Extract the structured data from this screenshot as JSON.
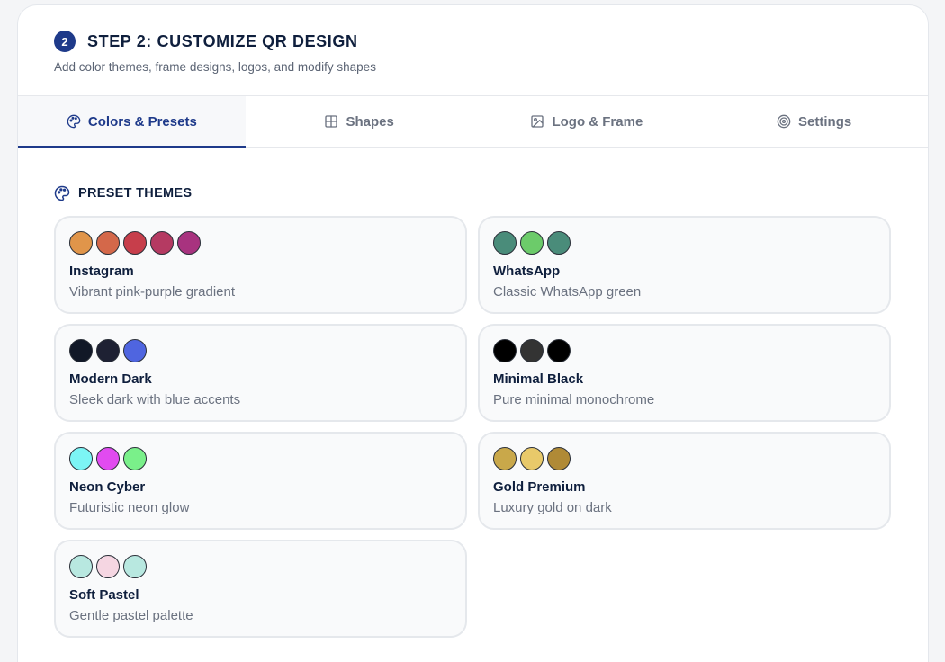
{
  "header": {
    "step_number": "2",
    "title": "STEP 2: CUSTOMIZE QR DESIGN",
    "subtitle": "Add color themes, frame designs, logos, and modify shapes"
  },
  "tabs": [
    {
      "label": "Colors & Presets",
      "icon": "palette-icon",
      "active": true
    },
    {
      "label": "Shapes",
      "icon": "grid-icon",
      "active": false
    },
    {
      "label": "Logo & Frame",
      "icon": "image-icon",
      "active": false
    },
    {
      "label": "Settings",
      "icon": "target-icon",
      "active": false
    }
  ],
  "section": {
    "title": "PRESET THEMES",
    "icon": "palette-icon"
  },
  "presets": [
    {
      "name": "Instagram",
      "description": "Vibrant pink-purple gradient",
      "colors": [
        "#E0954A",
        "#D4684A",
        "#C73E4B",
        "#B53A62",
        "#A8337F"
      ]
    },
    {
      "name": "WhatsApp",
      "description": "Classic WhatsApp green",
      "colors": [
        "#4A8C7A",
        "#6CCB6A",
        "#4A8C7A"
      ]
    },
    {
      "name": "Modern Dark",
      "description": "Sleek dark with blue accents",
      "colors": [
        "#111827",
        "#1E2133",
        "#4F65E0"
      ]
    },
    {
      "name": "Minimal Black",
      "description": "Pure minimal monochrome",
      "colors": [
        "#000000",
        "#333333",
        "#000000"
      ]
    },
    {
      "name": "Neon Cyber",
      "description": "Futuristic neon glow",
      "colors": [
        "#7CF5F5",
        "#E14BF0",
        "#7AF08A"
      ]
    },
    {
      "name": "Gold Premium",
      "description": "Luxury gold on dark",
      "colors": [
        "#C9A84A",
        "#E8C96A",
        "#B08A36"
      ]
    },
    {
      "name": "Soft Pastel",
      "description": "Gentle pastel palette",
      "colors": [
        "#B8E8E0",
        "#F5D6E2",
        "#B8E8E0"
      ]
    }
  ],
  "colors": {
    "accent": "#1E3A8A",
    "text_primary": "#0F1F3D",
    "text_muted": "#6B7280"
  }
}
